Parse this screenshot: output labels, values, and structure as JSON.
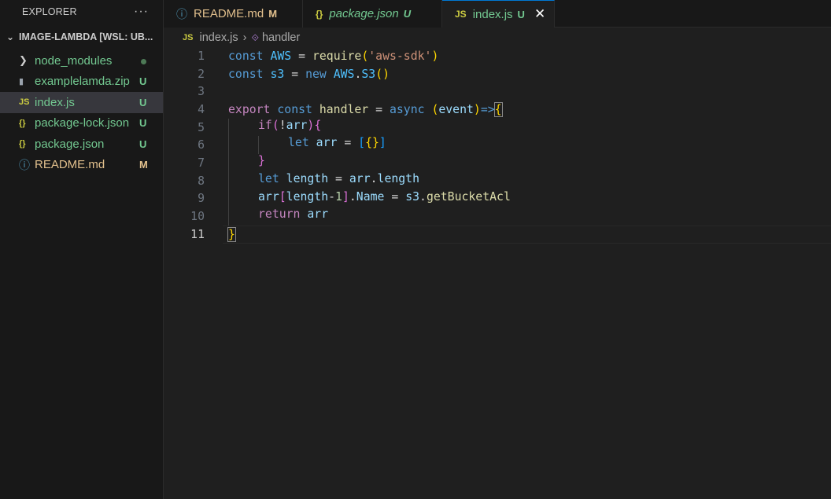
{
  "explorer": {
    "title": "EXPLORER",
    "more": "···",
    "root": "IMAGE-LAMBDA [WSL: UB..."
  },
  "files": [
    {
      "name": "node_modules",
      "icon": "chevron-right-icon",
      "badge": "",
      "kind": "folder"
    },
    {
      "name": "examplelamda.zip",
      "icon": "zip-icon",
      "badge": "U",
      "kind": "zip"
    },
    {
      "name": "index.js",
      "icon": "js-icon",
      "badge": "U",
      "kind": "js"
    },
    {
      "name": "package-lock.json",
      "icon": "json-icon",
      "badge": "U",
      "kind": "json"
    },
    {
      "name": "package.json",
      "icon": "json-icon",
      "badge": "U",
      "kind": "json"
    },
    {
      "name": "README.md",
      "icon": "info-icon",
      "badge": "M",
      "kind": "md"
    }
  ],
  "tabs": [
    {
      "label": "README.md",
      "badge": "M",
      "icon_text": "ⓘ"
    },
    {
      "label": "package.json",
      "badge": "U",
      "icon_text": "{}"
    },
    {
      "label": "index.js",
      "badge": "U",
      "icon_text": "JS",
      "close": "✕"
    }
  ],
  "breadcrumb": {
    "file_icon": "JS",
    "file": "index.js",
    "separator": "›",
    "symbol": "handler"
  },
  "line_numbers": [
    "1",
    "2",
    "3",
    "4",
    "5",
    "6",
    "7",
    "8",
    "9",
    "10",
    "11"
  ],
  "code": {
    "l1": [
      "const",
      "AWS",
      "=",
      "require",
      "(",
      "'aws-sdk'",
      ")"
    ],
    "l2": [
      "const",
      "s3",
      "=",
      "new",
      "AWS",
      ".",
      "S3",
      "()"
    ],
    "l4": [
      "export",
      "const",
      "handler",
      "=",
      "async",
      "(",
      "event",
      ")",
      "=>",
      "{"
    ],
    "l5": [
      "if",
      "(",
      "!",
      "arr",
      ")",
      "{"
    ],
    "l6": [
      "let",
      "arr",
      "=",
      "[",
      "{}",
      "]"
    ],
    "l7": [
      "}"
    ],
    "l8": [
      "let",
      "length",
      "=",
      "arr",
      ".",
      "length"
    ],
    "l9": [
      "arr",
      "[",
      "length",
      "-",
      "1",
      "]",
      ".",
      "Name",
      "=",
      "s3",
      ".",
      "getBucketAcl"
    ],
    "l10": [
      "return",
      "arr"
    ],
    "l11": [
      "}"
    ]
  },
  "colors": {
    "accent": "#0078d4",
    "untracked": "#73c991",
    "modified": "#e2c08d"
  }
}
